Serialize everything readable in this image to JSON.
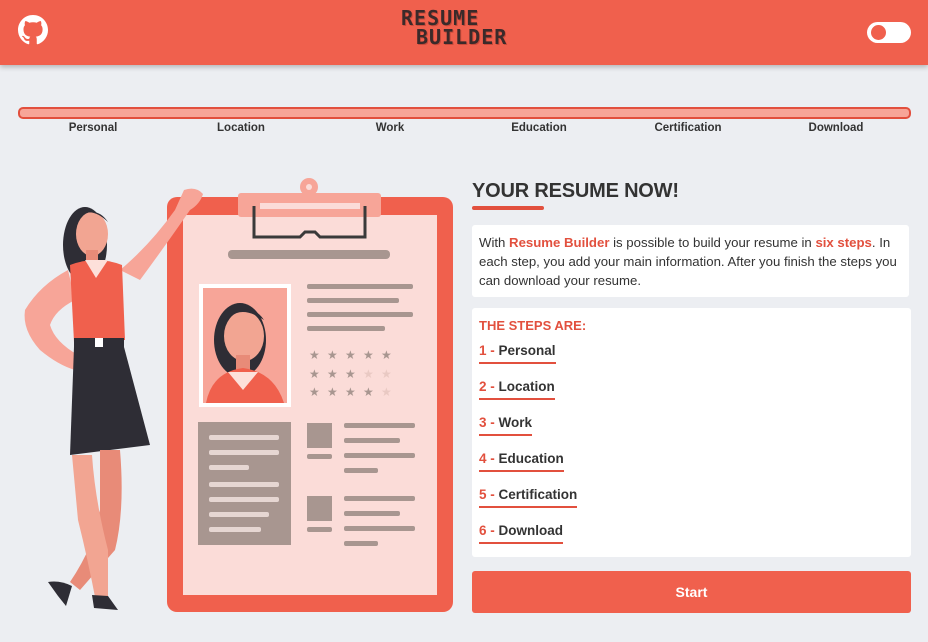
{
  "header": {
    "logo_line1": "RESUME",
    "logo_line2": "BUILDER",
    "github_icon": "github-icon",
    "theme_toggle": "toggle-switch"
  },
  "progress": {
    "value": 0,
    "steps": [
      "Personal",
      "Location",
      "Work",
      "Education",
      "Certification",
      "Download"
    ]
  },
  "main": {
    "title": "YOUR RESUME NOW!",
    "intro": {
      "part1": "With ",
      "brand": "Resume Builder",
      "part2": " is possible to build your resume in ",
      "highlight": "six steps",
      "part3": ". In each step, you add your main information. After you finish the steps you can download your resume."
    },
    "steps_title": "THE STEPS ARE:",
    "steps": [
      {
        "num": "1 -",
        "label": "Personal"
      },
      {
        "num": "2 -",
        "label": "Location"
      },
      {
        "num": "3 -",
        "label": "Work"
      },
      {
        "num": "4 -",
        "label": "Education"
      },
      {
        "num": "5 -",
        "label": "Certification"
      },
      {
        "num": "6 -",
        "label": "Download"
      }
    ],
    "start_label": "Start"
  },
  "colors": {
    "accent": "#f0604d",
    "accent_dark": "#e2503e",
    "background": "#eceef2"
  }
}
